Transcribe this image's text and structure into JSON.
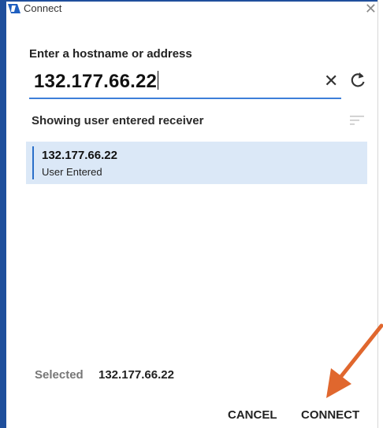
{
  "window": {
    "title": "Connect"
  },
  "host": {
    "label": "Enter a hostname or address",
    "value": "132.177.66.22"
  },
  "results": {
    "heading": "Showing user entered receiver",
    "items": [
      {
        "address": "132.177.66.22",
        "subtitle": "User Entered"
      }
    ]
  },
  "footer": {
    "selected_label": "Selected",
    "selected_value": "132.177.66.22",
    "cancel_label": "CANCEL",
    "connect_label": "CONNECT"
  },
  "colors": {
    "frame": "#1f4f9c",
    "accent": "#3d7fd9",
    "selection": "#dbe8f7",
    "arrow": "#e0672e"
  },
  "icons": [
    "app-icon",
    "close-icon",
    "clear-icon",
    "refresh-icon",
    "sort-icon",
    "annotation-arrow"
  ]
}
